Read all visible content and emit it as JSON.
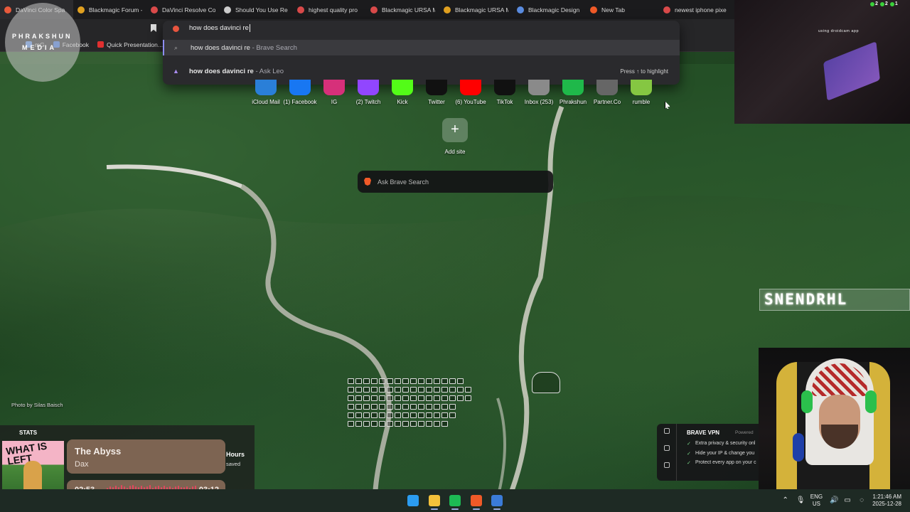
{
  "tabs": [
    {
      "title": "DaVinci Color Spa",
      "color": "#e85a3c",
      "active": true
    },
    {
      "title": "Blackmagic Forum -",
      "color": "#e0a020"
    },
    {
      "title": "DaVinci Resolve Co",
      "color": "#d94a4a"
    },
    {
      "title": "Should You Use Re",
      "color": "#cccccc"
    },
    {
      "title": "highest quality pro",
      "color": "#d94a4a"
    },
    {
      "title": "Blackmagic URSA M",
      "color": "#d94a4a"
    },
    {
      "title": "Blackmagic URSA M",
      "color": "#e0a020"
    },
    {
      "title": "Blackmagic Design",
      "color": "#5a8ce0"
    },
    {
      "title": "New Tab",
      "color": "#f05a28"
    },
    {
      "title": "newest iphone pixe",
      "color": "#d94a4a"
    }
  ],
  "bookmarks": [
    {
      "label": "mG",
      "color": "#5a8ce0"
    },
    {
      "label": "Facebook",
      "color": "#3b6fd8"
    },
    {
      "label": "Quick Presentation...",
      "color": "#e03030"
    }
  ],
  "omnibox": {
    "query": "how does davinci re",
    "suggestions": [
      {
        "query": "how does davinci re",
        "source": " - Brave Search"
      },
      {
        "query": "how does davinci re",
        "source": " - Ask Leo"
      }
    ],
    "hint": "Press ↑ to highlight"
  },
  "top_sites": [
    {
      "label": "iCloud Mail",
      "color": "#2a7fd8"
    },
    {
      "label": "(1) Facebook",
      "color": "#1877f2"
    },
    {
      "label": "IG",
      "color": "#d6307a"
    },
    {
      "label": "(2) Twitch",
      "color": "#9146ff"
    },
    {
      "label": "Kick",
      "color": "#53fc18"
    },
    {
      "label": "Twitter",
      "color": "#111111"
    },
    {
      "label": "(6) YouTube",
      "color": "#ff0000"
    },
    {
      "label": "TikTok",
      "color": "#111111"
    },
    {
      "label": "Inbox (253)",
      "color": "#8a8a8a"
    },
    {
      "label": "Phrakshun",
      "color": "#1fb84a"
    },
    {
      "label": "Partner.Co",
      "color": "#666666"
    },
    {
      "label": "rumble",
      "color": "#85c742"
    }
  ],
  "add_site_label": "Add site",
  "search_placeholder": "Ask Brave Search",
  "photo_credit": "Photo by Silas Baisch",
  "overlay_logo": {
    "line1": "PHRAKSHUN",
    "line2": "MEDIA"
  },
  "stream": {
    "caption": "using droidcam app",
    "counter_a": "2",
    "counter_b": "2",
    "counter_c": "1",
    "neon_text": "SNENDRHL"
  },
  "music": {
    "stats_label": "STATS",
    "album_text": "WHAT IS LEFT",
    "title": "The Abyss",
    "artist": "Dax",
    "current": "02:53",
    "duration": "03:12",
    "progress": 0.9,
    "hours_label": "Hours",
    "saved_label": "saved"
  },
  "vpn": {
    "title": "BRAVE VPN",
    "powered": "Powered",
    "features": [
      "Extra privacy & security onl",
      "Hide your IP & change you",
      "Protect every app on your c"
    ]
  },
  "taskbar": {
    "apps": [
      {
        "name": "windows-start-icon",
        "color": "#2b9cf0"
      },
      {
        "name": "file-explorer-icon",
        "color": "#f3c13a"
      },
      {
        "name": "spotify-icon",
        "color": "#1db954"
      },
      {
        "name": "brave-icon",
        "color": "#f05a28"
      },
      {
        "name": "python-app-icon",
        "color": "#3b7bd8"
      }
    ],
    "lang": "ENG",
    "region": "US",
    "time": "1:21:46 AM",
    "date": "2025-12-28"
  }
}
